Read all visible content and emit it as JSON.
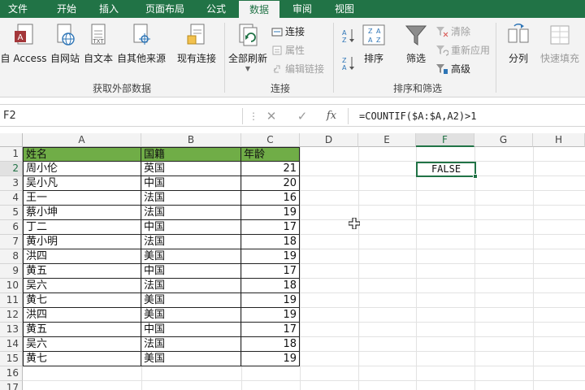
{
  "ribbon_tabs": [
    "文件",
    "开始",
    "插入",
    "页面布局",
    "公式",
    "数据",
    "审阅",
    "视图"
  ],
  "active_tab": "数据",
  "ribbon": {
    "external": {
      "access": "自 Access",
      "web": "自网站",
      "text": "自文本",
      "other": "自其他来源",
      "existing": "现有连接",
      "group_label": "获取外部数据"
    },
    "connections": {
      "refresh_all": "全部刷新",
      "connections": "连接",
      "properties": "属性",
      "edit_links": "编辑链接",
      "group_label": "连接"
    },
    "sort_filter": {
      "sort": "排序",
      "filter": "筛选",
      "clear": "清除",
      "reapply": "重新应用",
      "advanced": "高级",
      "group_label": "排序和筛选"
    },
    "tools": {
      "text_to_columns": "分列",
      "flash_fill": "快速填充"
    }
  },
  "formula_bar": {
    "name_box": "F2",
    "formula": "=COUNTIF($A:$A,A2)>1"
  },
  "columns": [
    "A",
    "B",
    "C",
    "D",
    "E",
    "F",
    "G",
    "H"
  ],
  "selected_column": "F",
  "row_numbers": [
    "1",
    "2",
    "3",
    "4",
    "5",
    "6",
    "7",
    "8",
    "9",
    "10",
    "11",
    "12",
    "13",
    "14",
    "15",
    "16",
    "17"
  ],
  "selected_row": "2",
  "table": {
    "headers": [
      "姓名",
      "国籍",
      "年龄"
    ],
    "rows": [
      [
        "周小伦",
        "英国",
        "21"
      ],
      [
        "吴小凡",
        "中国",
        "20"
      ],
      [
        "王一",
        "法国",
        "16"
      ],
      [
        "蔡小坤",
        "法国",
        "19"
      ],
      [
        "丁二",
        "中国",
        "17"
      ],
      [
        "黄小明",
        "法国",
        "18"
      ],
      [
        "洪四",
        "美国",
        "19"
      ],
      [
        "黄五",
        "中国",
        "17"
      ],
      [
        "吴六",
        "法国",
        "18"
      ],
      [
        "黄七",
        "美国",
        "19"
      ],
      [
        "洪四",
        "美国",
        "19"
      ],
      [
        "黄五",
        "中国",
        "17"
      ],
      [
        "吴六",
        "法国",
        "18"
      ],
      [
        "黄七",
        "美国",
        "19"
      ]
    ]
  },
  "f2_value": "FALSE",
  "colors": {
    "accent": "#217346",
    "header_fill": "#70ad47"
  }
}
